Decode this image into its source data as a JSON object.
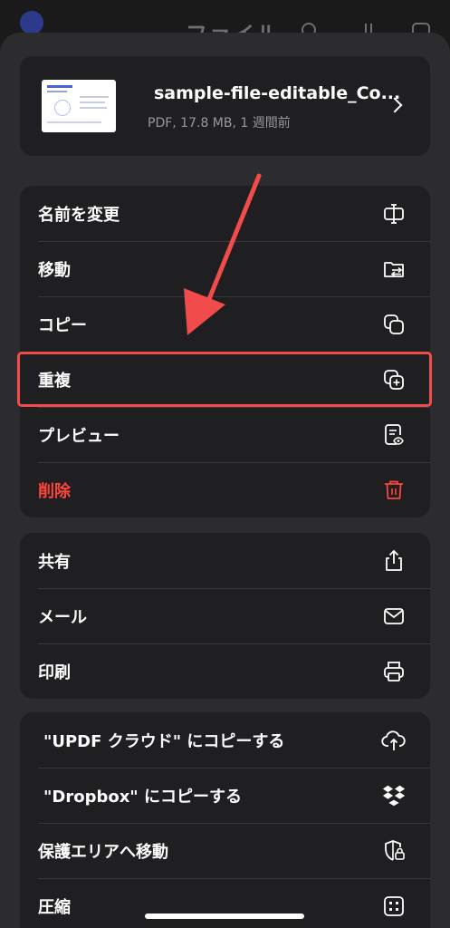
{
  "background": {
    "title": "ファイル"
  },
  "file": {
    "name": "sample-file-editable_Co...",
    "meta": "PDF, 17.8 MB, 1 週間前"
  },
  "groups": [
    {
      "items": [
        {
          "label": "名前を変更",
          "icon": "rename-icon"
        },
        {
          "label": "移動",
          "icon": "move-folder-icon"
        },
        {
          "label": "コピー",
          "icon": "copy-icon"
        },
        {
          "label": "重複",
          "icon": "duplicate-icon"
        },
        {
          "label": "プレビュー",
          "icon": "preview-icon"
        },
        {
          "label": "削除",
          "icon": "trash-icon"
        }
      ]
    },
    {
      "items": [
        {
          "label": "共有",
          "icon": "share-icon"
        },
        {
          "label": "メール",
          "icon": "mail-icon"
        },
        {
          "label": "印刷",
          "icon": "print-icon"
        }
      ]
    },
    {
      "items": [
        {
          "label": "\"UPDF クラウド\" にコピーする",
          "icon": "cloud-upload-icon"
        },
        {
          "label": "\"Dropbox\" にコピーする",
          "icon": "dropbox-icon"
        },
        {
          "label": "保護エリアへ移動",
          "icon": "shield-lock-icon"
        },
        {
          "label": "圧縮",
          "icon": "compress-icon"
        }
      ]
    }
  ],
  "colors": {
    "danger": "#ff453a",
    "highlight": "#f24b4b"
  }
}
